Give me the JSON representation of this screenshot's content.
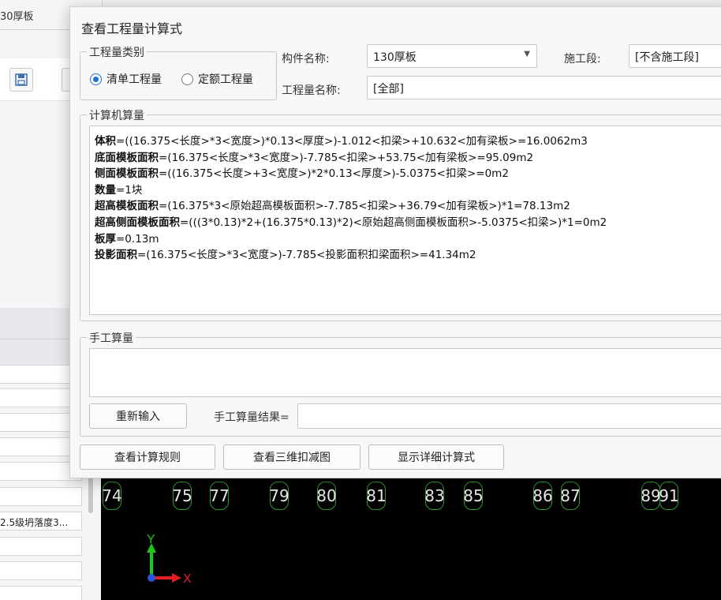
{
  "background": {
    "tab_label": "30厚板",
    "row_text": "2.5级坍落度3...",
    "axis_labels": [
      "74",
      "75",
      "77",
      "79",
      "80",
      "81",
      "83",
      "85",
      "86",
      "87",
      "89",
      "91"
    ],
    "triad": {
      "y_label": "Y",
      "x_label": "X",
      "y_color": "#22c422",
      "x_color": "#e02020"
    }
  },
  "dialog": {
    "title": "查看工程量计算式",
    "category": {
      "caption": "工程量类别",
      "options": [
        {
          "label": "清单工程量",
          "selected": true
        },
        {
          "label": "定额工程量",
          "selected": false
        }
      ]
    },
    "component": {
      "label": "构件名称:",
      "value": "130厚板"
    },
    "stage": {
      "label": "施工段:",
      "value": "[不含施工段]"
    },
    "quantity_name": {
      "label": "工程量名称:",
      "value": "[全部]"
    },
    "computer": {
      "caption": "计算机算量",
      "formulas": [
        {
          "name": "体积",
          "expr": "=((16.375<长度>*3<宽度>)*0.13<厚度>)-1.012<扣梁>+10.632<加有梁板>=16.0062m3"
        },
        {
          "name": "底面模板面积",
          "expr": "=(16.375<长度>*3<宽度>)-7.785<扣梁>+53.75<加有梁板>=95.09m2"
        },
        {
          "name": "侧面模板面积",
          "expr": "=((16.375<长度>+3<宽度>)*2*0.13<厚度>)-5.0375<扣梁>=0m2"
        },
        {
          "name": "数量",
          "expr": "=1块"
        },
        {
          "name": "超高模板面积",
          "expr": "=(16.375*3<原始超高模板面积>-7.785<扣梁>+36.79<加有梁板>)*1=78.13m2"
        },
        {
          "name": "超高侧面模板面积",
          "expr": "=(((3*0.13)*2+(16.375*0.13)*2)<原始超高侧面模板面积>-5.0375<扣梁>)*1=0m2"
        },
        {
          "name": "板厚",
          "expr": "=0.13m"
        },
        {
          "name": "投影面积",
          "expr": "=(16.375<长度>*3<宽度>)-7.785<投影面积扣梁面积>=41.34m2"
        }
      ]
    },
    "manual": {
      "caption": "手工算量",
      "reenter_button": "重新输入",
      "result_label": "手工算量结果=",
      "result_value": ""
    },
    "buttons": {
      "view_rules": "查看计算规则",
      "view_3d": "查看三维扣减图",
      "show_detail": "显示详细计算式"
    },
    "colors": {
      "accent": "#1e6fd9",
      "canvas": "#000000",
      "axis_green": "#2f9a2f"
    }
  }
}
